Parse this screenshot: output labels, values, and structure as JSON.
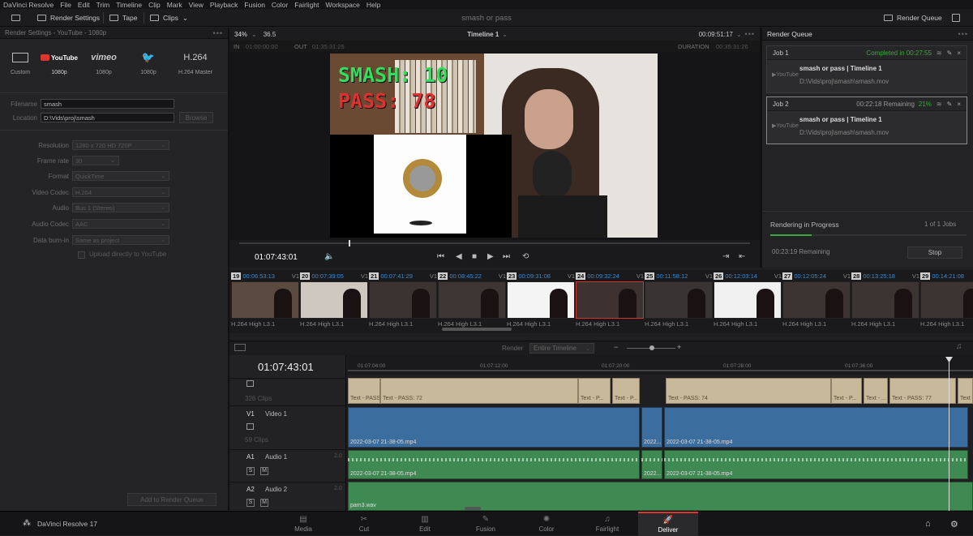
{
  "app": {
    "menu": [
      "DaVinci Resolve",
      "File",
      "Edit",
      "Trim",
      "Timeline",
      "Clip",
      "Mark",
      "View",
      "Playback",
      "Fusion",
      "Color",
      "Fairlight",
      "Workspace",
      "Help"
    ],
    "name": "DaVinci Resolve 17"
  },
  "toolbar": {
    "render_settings": "Render Settings",
    "tape": "Tape",
    "clips": "Clips",
    "project_title": "smash or pass",
    "render_queue": "Render Queue"
  },
  "render_settings": {
    "header": "Render Settings - YouTube - 1080p",
    "presets": [
      {
        "logo": "Custom",
        "label": "Custom"
      },
      {
        "logo": "YouTube",
        "label": "1080p"
      },
      {
        "logo": "vimeo",
        "label": "1080p"
      },
      {
        "logo": "twitter",
        "label": "1080p"
      },
      {
        "logo": "H.264",
        "label": "H.264 Master"
      }
    ],
    "filename_label": "Filename",
    "filename": "smash",
    "location_label": "Location",
    "location": "D:\\Vids\\proj\\smash",
    "browse": "Browse",
    "fields": [
      {
        "label": "Resolution",
        "value": "1280 x 720 HD 720P"
      },
      {
        "label": "Frame rate",
        "value": "30"
      },
      {
        "label": "Format",
        "value": "QuickTime"
      },
      {
        "label": "Video Codec",
        "value": "H.264"
      },
      {
        "label": "Audio",
        "value": "Bus 1 (Stereo)"
      },
      {
        "label": "Audio Codec",
        "value": "AAC"
      },
      {
        "label": "Data burn-in",
        "value": "Same as project"
      }
    ],
    "upload": "Upload directly to YouTube",
    "add_to_queue": "Add to Render Queue"
  },
  "viewer": {
    "zoom": "34%",
    "fps": "36.5",
    "timeline": "Timeline 1",
    "tc_top": "00:09:51:17",
    "in_label": "IN",
    "in_tc": "01:00:00:00",
    "out_label": "OUT",
    "out_tc": "01:35:31:25",
    "duration_label": "DURATION",
    "duration": "00:35:31:26",
    "smash": "SMASH: 10",
    "pass": "PASS: 78",
    "current_tc": "01:07:43:01"
  },
  "queue": {
    "title": "Render Queue",
    "jobs": [
      {
        "name": "Job 1",
        "status": "Completed in 00:27:55",
        "pct": "",
        "title": "smash or pass | Timeline 1",
        "path": "D:\\Vids\\proj\\smash\\smash.mov"
      },
      {
        "name": "Job 2",
        "status": "00:22:18 Remaining",
        "pct": "21%",
        "title": "smash or pass | Timeline 1",
        "path": "D:\\Vids\\proj\\smash\\smash.mov"
      }
    ],
    "progress_label": "Rendering in Progress",
    "progress_count": "1 of 1 Jobs",
    "remaining": "00:23:19 Remaining",
    "stop": "Stop",
    "progress_fraction": 0.21
  },
  "clips": [
    {
      "num": "19",
      "tc": "00:06:53:13",
      "track": "V1",
      "codec": "H.264 High L3.1"
    },
    {
      "num": "20",
      "tc": "00:07:39:05",
      "track": "V1",
      "codec": "H.264 High L3.1"
    },
    {
      "num": "21",
      "tc": "00:07:41:29",
      "track": "V1",
      "codec": "H.264 High L3.1"
    },
    {
      "num": "22",
      "tc": "00:08:45:22",
      "track": "V1",
      "codec": "H.264 High L3.1"
    },
    {
      "num": "23",
      "tc": "00:09:31:08",
      "track": "V1",
      "codec": "H.264 High L3.1"
    },
    {
      "num": "24",
      "tc": "00:09:32:24",
      "track": "V1",
      "codec": "H.264 High L3.1"
    },
    {
      "num": "25",
      "tc": "00:11:58:12",
      "track": "V1",
      "codec": "H.264 High L3.1"
    },
    {
      "num": "26",
      "tc": "00:12:03:14",
      "track": "V1",
      "codec": "H.264 High L3.1"
    },
    {
      "num": "27",
      "tc": "00:12:05:24",
      "track": "V1",
      "codec": "H.264 High L3.1"
    },
    {
      "num": "28",
      "tc": "00:13:25:18",
      "track": "V1",
      "codec": "H.264 High L3.1"
    },
    {
      "num": "29",
      "tc": "00:14:21:08",
      "track": "V1",
      "codec": "H.264 High L3.1"
    }
  ],
  "timeline": {
    "render_label": "Render",
    "render_scope": "Entire Timeline",
    "current_tc": "01:07:43:01",
    "ruler": [
      "01:07:04:00",
      "01:07:12:00",
      "01:07:20:00",
      "01:07:28:00",
      "01:07:36:00"
    ],
    "text_track_count": "326 Clips",
    "v1": {
      "id": "V1",
      "name": "Video 1",
      "count": "59 Clips"
    },
    "a1": {
      "id": "A1",
      "name": "Audio 1",
      "level": "2.0"
    },
    "a2": {
      "id": "A2",
      "name": "Audio 2",
      "level": "2.0"
    },
    "text_clips": [
      "Text - PASS: 71",
      "Text - PASS: 72",
      "Text - P...",
      "Text - P...",
      "Text - PASS: 74",
      "Text - P...",
      "Text - ...",
      "Text - PASS: 77",
      "Text -"
    ],
    "video_clip": "2022-03-07 21-38-05.mp4",
    "video_clip_short": "2022...",
    "a2_clip": "pam3.wav"
  },
  "pages": [
    "Media",
    "Cut",
    "Edit",
    "Fusion",
    "Color",
    "Fairlight",
    "Deliver"
  ],
  "colors": {
    "accent_red": "#e0342c",
    "timecode_blue": "#3a8ad0",
    "complete_green": "#3fa63f"
  }
}
